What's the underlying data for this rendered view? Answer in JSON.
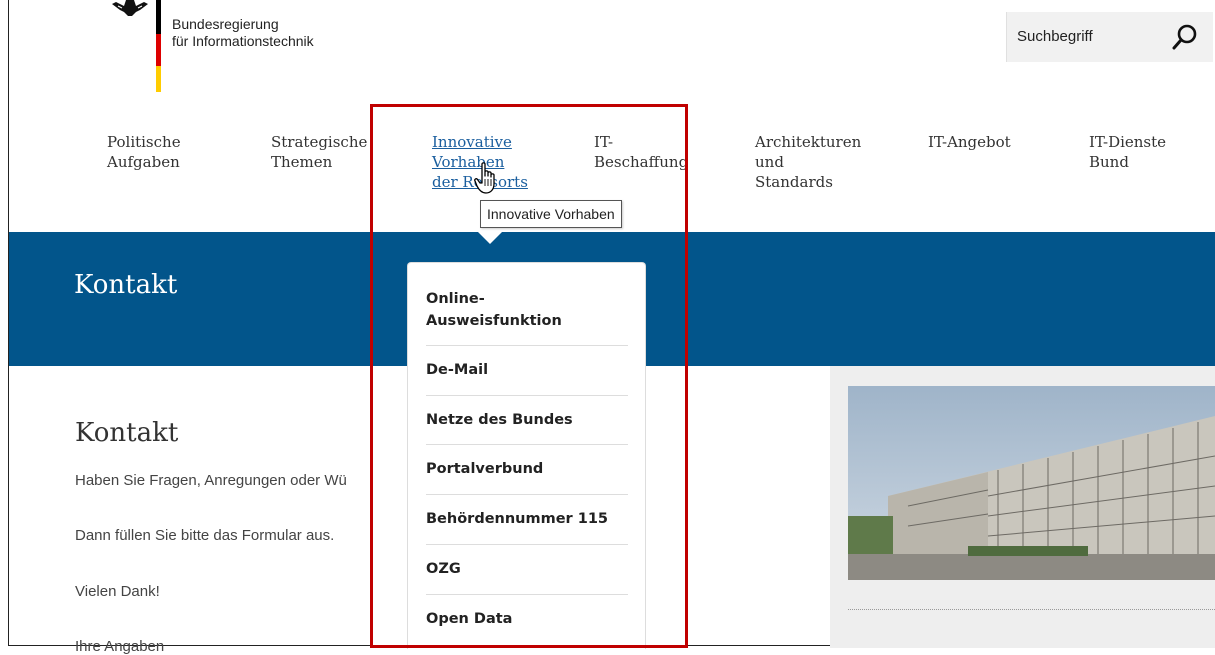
{
  "header": {
    "org_line1": "Bundesregierung",
    "org_line2": "für Informationstechnik",
    "search_placeholder": "Suchbegriff",
    "search_icon": "search-icon"
  },
  "nav": {
    "items": [
      {
        "line1": "Politische",
        "line2": "Aufgaben",
        "line3": ""
      },
      {
        "line1": "Strategische",
        "line2": "Themen",
        "line3": ""
      },
      {
        "line1": "Innovative",
        "line2": "Vorhaben",
        "line3": "der Ressorts"
      },
      {
        "line1": "IT-",
        "line2": "Beschaffung",
        "line3": ""
      },
      {
        "line1": "Architekturen",
        "line2": "und",
        "line3": "Standards"
      },
      {
        "line1": "IT-Angebot",
        "line2": "",
        "line3": ""
      },
      {
        "line1": "IT-Dienste",
        "line2": "Bund",
        "line3": ""
      }
    ],
    "active_color": "#1a5e9e"
  },
  "tooltip": "Innovative Vorhaben",
  "banner": {
    "title": "Kontakt",
    "color": "#02558b"
  },
  "dropdown": {
    "items": [
      {
        "line1": "Online-",
        "line2": "Ausweisfunktion"
      },
      {
        "line1": "De-Mail",
        "line2": ""
      },
      {
        "line1": "Netze des Bundes",
        "line2": ""
      },
      {
        "line1": "Portalverbund",
        "line2": ""
      },
      {
        "line1": "Behördennummer 115",
        "line2": ""
      },
      {
        "line1": "OZG",
        "line2": ""
      },
      {
        "line1": "Open Data",
        "line2": ""
      }
    ]
  },
  "content": {
    "title": "Kontakt",
    "p1": "Haben Sie Fragen, Anregungen oder Wü",
    "p2": "Dann füllen Sie bitte das Formular aus.",
    "p3": "Vielen Dank!",
    "p4": "Ihre Angaben"
  },
  "highlight_color": "#c00000"
}
